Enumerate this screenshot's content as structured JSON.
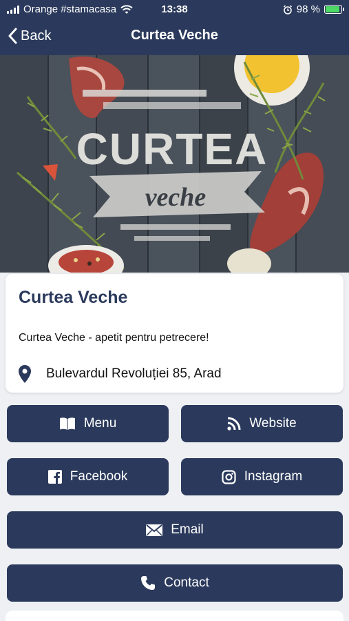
{
  "status_bar": {
    "carrier": "Orange #stamacasa",
    "time": "13:38",
    "battery": "98 %"
  },
  "nav": {
    "back_label": "Back",
    "title": "Curtea Veche"
  },
  "hero": {
    "logo_top": "CURTEA",
    "logo_bottom": "veche"
  },
  "info": {
    "name": "Curtea Veche",
    "description": "Curtea Veche - apetit pentru petrecere!",
    "address": "Bulevardul Revoluției 85, Arad"
  },
  "buttons": {
    "menu": "Menu",
    "website": "Website",
    "facebook": "Facebook",
    "instagram": "Instagram",
    "email": "Email",
    "contact": "Contact"
  },
  "colors": {
    "primary": "#2b3a5c",
    "background": "#eef0f4"
  }
}
